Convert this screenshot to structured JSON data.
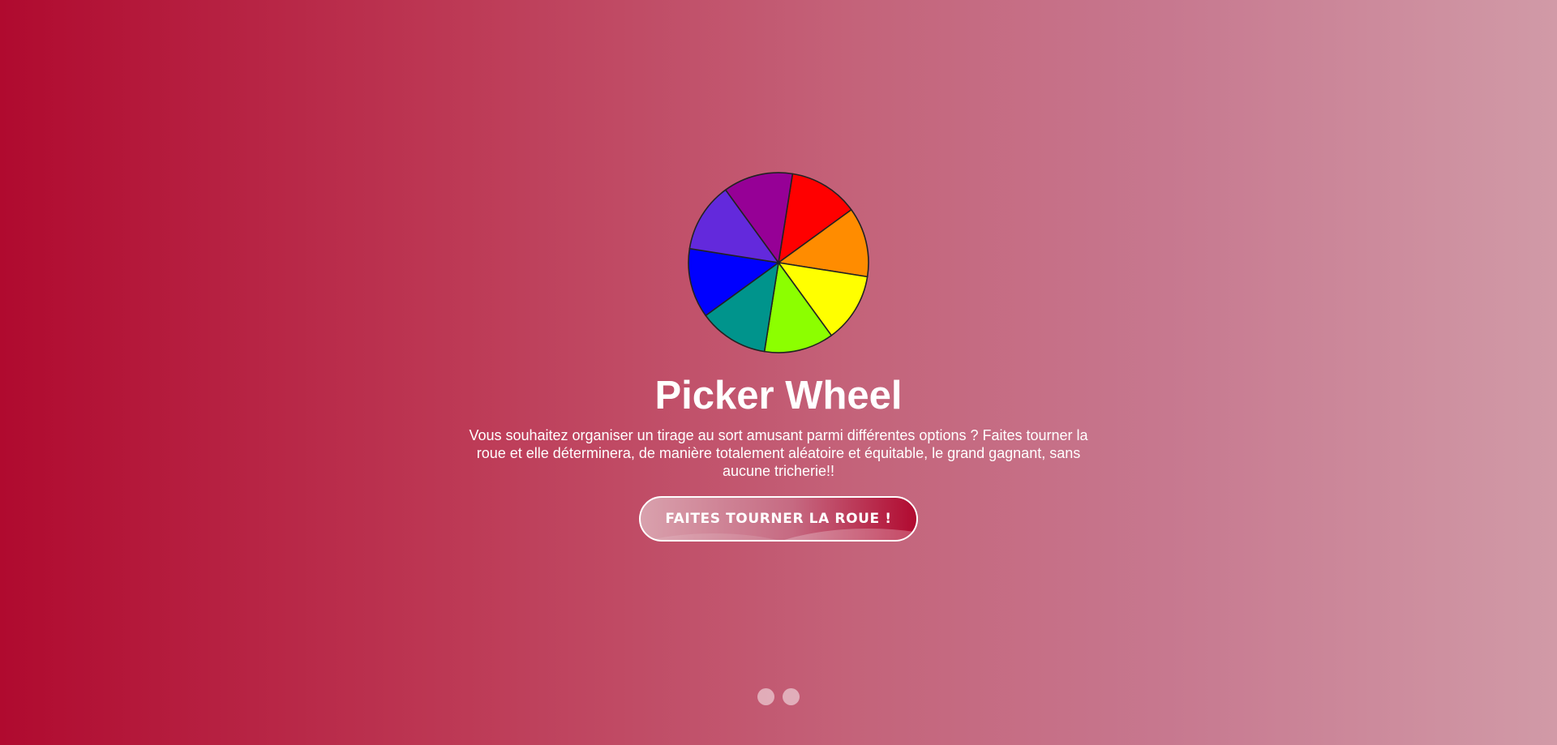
{
  "page": {
    "title": "Picker Wheel",
    "description": "Vous souhaitez organiser un tirage au sort amusant parmi différentes options ? Faites tourner la roue et elle déterminera, de manière totalement aléatoire et équitable, le grand gagnant, sans aucune tricherie!!",
    "spin_button_label": "FAITES TOURNER LA ROUE !"
  },
  "wheel": {
    "icon": "picker-wheel-icon",
    "segment_colors": [
      "#ff0000",
      "#ff8c00",
      "#ffff00",
      "#8cff00",
      "#00948c",
      "#0000ff",
      "#6329dc",
      "#960096"
    ],
    "outline_color": "#222222"
  },
  "carousel": {
    "dot_count": 2
  },
  "colors": {
    "background_left": "#b00a2f",
    "background_right": "#d19aa7",
    "text": "#ffffff"
  }
}
